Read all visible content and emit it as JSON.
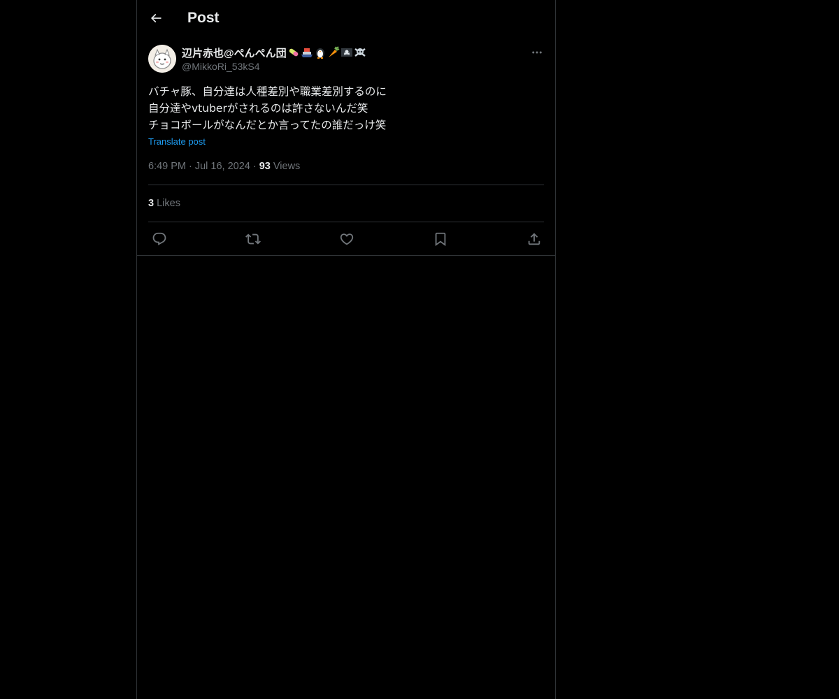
{
  "header": {
    "title": "Post",
    "back_icon": "arrow-left-icon"
  },
  "author": {
    "display_name": "辺片赤也@ぺんぺん団",
    "display_emojis": [
      "pill-emoji",
      "ship-emoji",
      "penguin-emoji",
      "carrot-emoji",
      "pirate-flag-emoji",
      "skull-crossbones-emoji"
    ],
    "handle": "@MikkoRi_53kS4"
  },
  "post": {
    "lines": [
      "バチャ豚、自分達は人種差別や職業差別するのに",
      "自分達やvtuberがされるのは許さないんだ笑",
      "チョコボールがなんだとか言ってたの誰だっけ笑"
    ],
    "translate_label": "Translate post",
    "time": "6:49 PM",
    "date": "Jul 16, 2024",
    "views_count": "93",
    "views_label": "Views",
    "likes_count": "3",
    "likes_label": "Likes"
  },
  "actions": [
    {
      "name": "reply",
      "icon": "reply-icon"
    },
    {
      "name": "repost",
      "icon": "repost-icon"
    },
    {
      "name": "like",
      "icon": "heart-icon"
    },
    {
      "name": "bookmark",
      "icon": "bookmark-icon"
    },
    {
      "name": "share",
      "icon": "share-icon"
    }
  ],
  "colors": {
    "background": "#000000",
    "text_primary": "#e7e9ea",
    "text_secondary": "#71767b",
    "link": "#1d9bf0",
    "border": "#2f3336"
  }
}
